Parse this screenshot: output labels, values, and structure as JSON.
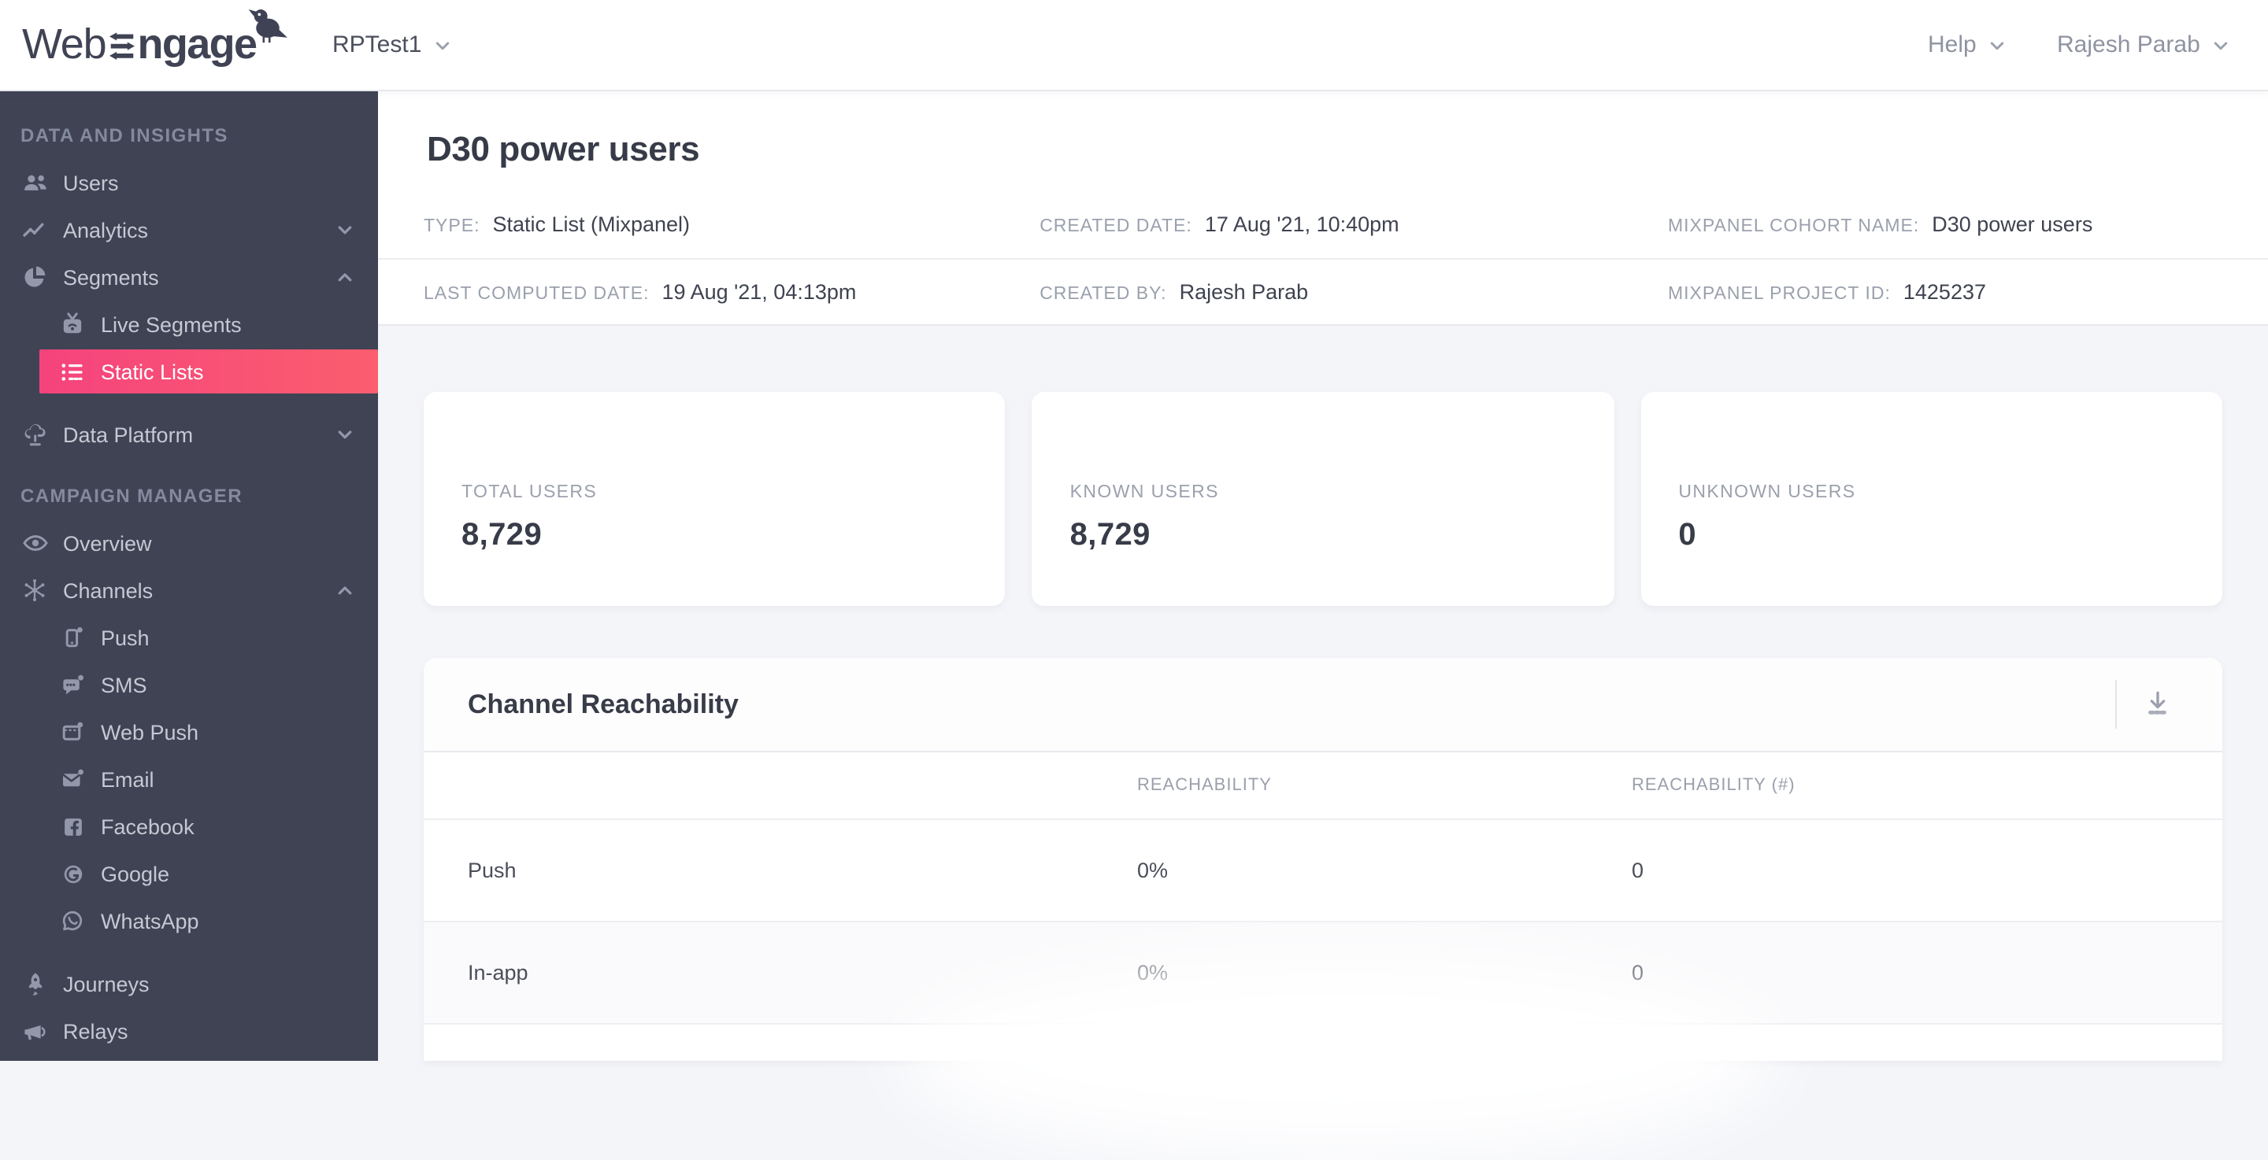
{
  "topbar": {
    "logo_prefix": "Web",
    "logo_suffix": "ngage",
    "project_name": "RPTest1",
    "help_label": "Help",
    "user_name": "Rajesh Parab"
  },
  "sidebar": {
    "sections": [
      {
        "label": "DATA AND INSIGHTS",
        "items": [
          {
            "label": "Users"
          },
          {
            "label": "Analytics"
          },
          {
            "label": "Segments"
          },
          {
            "label": "Live Segments"
          },
          {
            "label": "Static Lists"
          },
          {
            "label": "Data Platform"
          }
        ]
      },
      {
        "label": "CAMPAIGN MANAGER",
        "items": [
          {
            "label": "Overview"
          },
          {
            "label": "Channels"
          },
          {
            "label": "Push"
          },
          {
            "label": "SMS"
          },
          {
            "label": "Web Push"
          },
          {
            "label": "Email"
          },
          {
            "label": "Facebook"
          },
          {
            "label": "Google"
          },
          {
            "label": "WhatsApp"
          },
          {
            "label": "Journeys"
          },
          {
            "label": "Relays"
          }
        ]
      }
    ]
  },
  "page": {
    "title": "D30 power users",
    "meta": {
      "type_label": "TYPE:",
      "type_value": "Static List (Mixpanel)",
      "created_date_label": "CREATED DATE:",
      "created_date_value": "17 Aug '21, 10:40pm",
      "cohort_label": "MIXPANEL COHORT NAME:",
      "cohort_value": "D30 power users",
      "computed_label": "LAST COMPUTED DATE:",
      "computed_value": "19 Aug '21, 04:13pm",
      "created_by_label": "CREATED BY:",
      "created_by_value": "Rajesh Parab",
      "project_id_label": "MIXPANEL PROJECT ID:",
      "project_id_value": "1425237"
    }
  },
  "stats": {
    "cards": [
      {
        "label": "TOTAL USERS",
        "value": "8,729"
      },
      {
        "label": "KNOWN USERS",
        "value": "8,729"
      },
      {
        "label": "UNKNOWN USERS",
        "value": "0"
      }
    ]
  },
  "reachability": {
    "title": "Channel Reachability",
    "col2": "REACHABILITY",
    "col3": "REACHABILITY (#)",
    "rows": [
      {
        "channel": "Push",
        "reachability": "0%",
        "count": "0"
      },
      {
        "channel": "In-app",
        "reachability": "0%",
        "count": "0"
      }
    ]
  },
  "colors": {
    "sidebar_bg": "#3f4354",
    "accent_pink_start": "#f5437d",
    "accent_pink_end": "#fb5e6e",
    "main_bg": "#f4f5f9",
    "text_dark": "#383c48",
    "text_muted": "#9aa0ac"
  }
}
